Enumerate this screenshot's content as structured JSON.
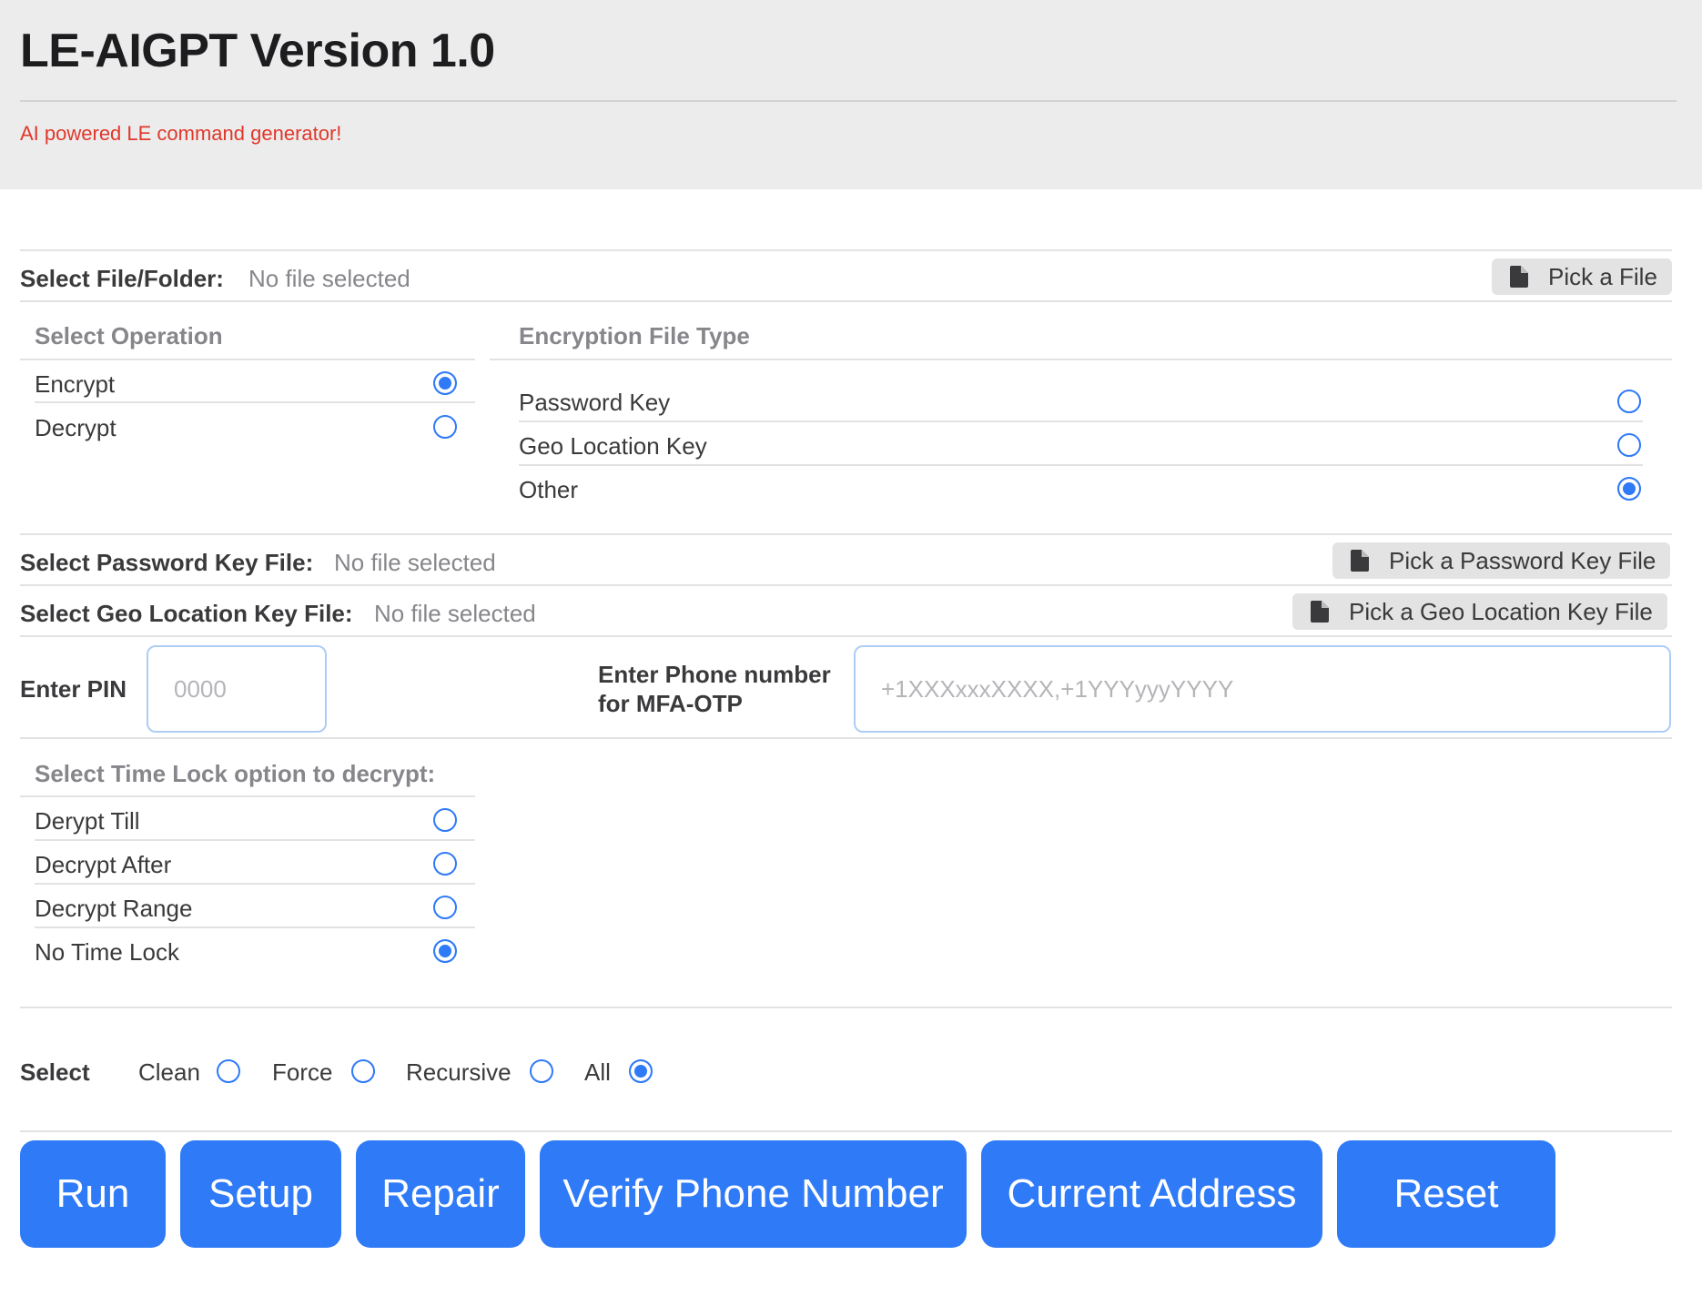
{
  "header": {
    "title": "LE-AIGPT Version 1.0",
    "subtitle": "AI powered LE command generator!"
  },
  "file_select": {
    "label": "Select File/Folder:",
    "status": "No file selected",
    "button": "Pick a File"
  },
  "operation": {
    "title": "Select Operation",
    "options": [
      {
        "label": "Encrypt",
        "checked": true
      },
      {
        "label": "Decrypt",
        "checked": false
      }
    ]
  },
  "encryption_type": {
    "title": "Encryption File Type",
    "options": [
      {
        "label": "Password Key",
        "checked": false
      },
      {
        "label": "Geo Location Key",
        "checked": false
      },
      {
        "label": "Other",
        "checked": true
      }
    ]
  },
  "password_key_file": {
    "label": "Select Password Key File:",
    "status": "No file selected",
    "button": "Pick a Password Key File"
  },
  "geo_key_file": {
    "label": "Select Geo Location Key File:",
    "status": "No file selected",
    "button": "Pick a Geo Location Key File"
  },
  "pin": {
    "label": "Enter PIN",
    "placeholder": "0000"
  },
  "phone": {
    "label_line1": "Enter Phone number",
    "label_line2": "for MFA-OTP",
    "placeholder": "+1XXXxxxXXXX,+1YYYyyyYYYY"
  },
  "time_lock": {
    "title": "Select Time Lock option to decrypt:",
    "options": [
      {
        "label": "Derypt Till",
        "checked": false
      },
      {
        "label": "Decrypt After",
        "checked": false
      },
      {
        "label": "Decrypt Range",
        "checked": false
      },
      {
        "label": "No Time Lock",
        "checked": true
      }
    ]
  },
  "select_flags": {
    "label": "Select",
    "options": [
      {
        "label": "Clean",
        "checked": false
      },
      {
        "label": "Force",
        "checked": false
      },
      {
        "label": "Recursive",
        "checked": false
      },
      {
        "label": "All",
        "checked": true
      }
    ]
  },
  "actions": {
    "run": "Run",
    "setup": "Setup",
    "repair": "Repair",
    "verify_phone": "Verify Phone Number",
    "current_address": "Current Address",
    "reset": "Reset"
  },
  "colors": {
    "accent": "#2f7af7",
    "subtitle": "#e0382b",
    "header_bg": "#ececec"
  }
}
